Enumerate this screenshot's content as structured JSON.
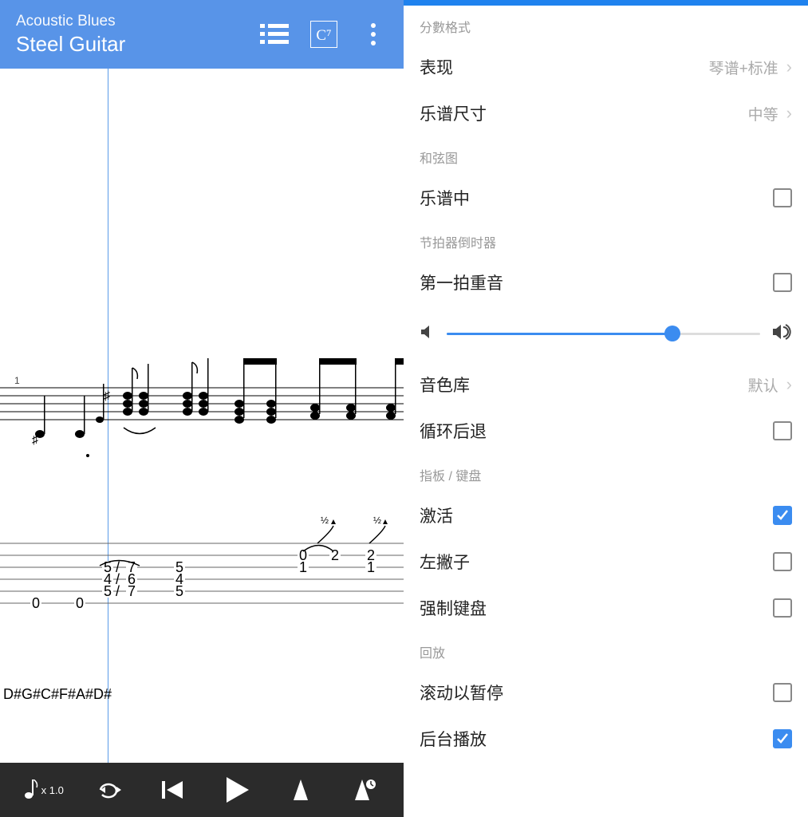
{
  "header": {
    "song_title": "Acoustic Blues",
    "track_title": "Steel Guitar"
  },
  "footer": {
    "tempo_label": "x 1.0"
  },
  "tuning_text": "D#G#C#F#A#D#",
  "settings": {
    "section_score_format": "分數格式",
    "row_display": {
      "label": "表现",
      "value": "琴谱+标准"
    },
    "row_score_size": {
      "label": "乐谱尺寸",
      "value": "中等"
    },
    "section_chord_diagram": "和弦图",
    "row_in_score": {
      "label": "乐谱中",
      "checked": false
    },
    "section_metronome": "节拍器倒时器",
    "row_first_beat_accent": {
      "label": "第一拍重音",
      "checked": false
    },
    "volume": {
      "value": 72
    },
    "row_soundbank": {
      "label": "音色库",
      "value": "默认"
    },
    "row_loop_rewind": {
      "label": "循环后退",
      "checked": false
    },
    "section_fretboard": "指板 / 键盘",
    "row_activate": {
      "label": "激活",
      "checked": true
    },
    "row_lefty": {
      "label": "左撇子",
      "checked": false
    },
    "row_force_keyboard": {
      "label": "强制键盘",
      "checked": false
    },
    "section_playback": "回放",
    "row_scroll_pause": {
      "label": "滚动以暂停",
      "checked": false
    },
    "row_background_play": {
      "label": "后台播放",
      "checked": true
    }
  }
}
